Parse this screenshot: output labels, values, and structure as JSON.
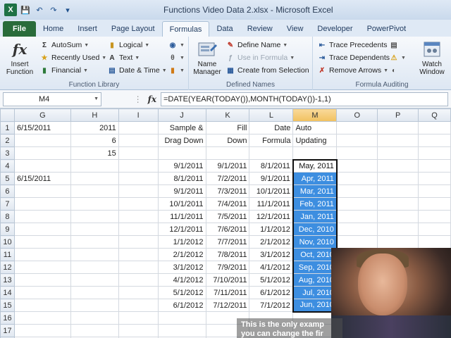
{
  "window": {
    "title": "Functions Video Data 2.xlsx - Microsoft Excel"
  },
  "ribbon_tabs": [
    {
      "label": "File"
    },
    {
      "label": "Home"
    },
    {
      "label": "Insert"
    },
    {
      "label": "Page Layout"
    },
    {
      "label": "Formulas"
    },
    {
      "label": "Data"
    },
    {
      "label": "Review"
    },
    {
      "label": "View"
    },
    {
      "label": "Developer"
    },
    {
      "label": "PowerPivot"
    }
  ],
  "active_tab": "Formulas",
  "ribbon": {
    "function_library": {
      "label": "Function Library",
      "insert_function": "Insert Function",
      "autosum": "AutoSum",
      "recently_used": "Recently Used",
      "financial": "Financial",
      "logical": "Logical",
      "text": "Text",
      "date_time": "Date & Time"
    },
    "defined_names": {
      "label": "Defined Names",
      "name_manager": "Name Manager",
      "define_name": "Define Name",
      "use_in_formula": "Use in Formula",
      "create_from_selection": "Create from Selection"
    },
    "formula_auditing": {
      "label": "Formula Auditing",
      "trace_precedents": "Trace Precedents",
      "trace_dependents": "Trace Dependents",
      "remove_arrows": "Remove Arrows",
      "watch_window": "Watch Window"
    }
  },
  "formula_bar": {
    "name_box": "M4",
    "fx": "fx",
    "formula": "=DATE(YEAR(TODAY()),MONTH(TODAY())-1,1)"
  },
  "grid": {
    "columns": [
      "G",
      "H",
      "I",
      "J",
      "K",
      "L",
      "M",
      "O",
      "P",
      "Q"
    ],
    "selected_column": "M",
    "rows": [
      {
        "num": "1",
        "G": "6/15/2011",
        "H": "2011",
        "I": "",
        "J": "Sample &",
        "K": "Fill",
        "L": "Date",
        "M": "Auto",
        "O": "",
        "P": "",
        "Q": ""
      },
      {
        "num": "2",
        "G": "",
        "H": "6",
        "I": "",
        "J": "Drag Down",
        "K": "Down",
        "L": "Formula",
        "M": "Updating",
        "O": "",
        "P": "",
        "Q": ""
      },
      {
        "num": "3",
        "G": "",
        "H": "15",
        "I": "",
        "J": "",
        "K": "",
        "L": "",
        "M": "",
        "O": "",
        "P": "",
        "Q": ""
      },
      {
        "num": "4",
        "G": "",
        "H": "",
        "I": "",
        "J": "9/1/2011",
        "K": "9/1/2011",
        "L": "8/1/2011",
        "M": "May, 2011",
        "O": "",
        "P": "",
        "Q": ""
      },
      {
        "num": "5",
        "G": "6/15/2011",
        "H": "",
        "I": "",
        "J": "8/1/2011",
        "K": "7/2/2011",
        "L": "9/1/2011",
        "M": "Apr, 2011",
        "O": "",
        "P": "",
        "Q": ""
      },
      {
        "num": "6",
        "G": "",
        "H": "",
        "I": "",
        "J": "9/1/2011",
        "K": "7/3/2011",
        "L": "10/1/2011",
        "M": "Mar, 2011",
        "O": "",
        "P": "",
        "Q": ""
      },
      {
        "num": "7",
        "G": "",
        "H": "",
        "I": "",
        "J": "10/1/2011",
        "K": "7/4/2011",
        "L": "11/1/2011",
        "M": "Feb, 2011",
        "O": "",
        "P": "",
        "Q": ""
      },
      {
        "num": "8",
        "G": "",
        "H": "",
        "I": "",
        "J": "11/1/2011",
        "K": "7/5/2011",
        "L": "12/1/2011",
        "M": "Jan, 2011",
        "O": "",
        "P": "",
        "Q": ""
      },
      {
        "num": "9",
        "G": "",
        "H": "",
        "I": "",
        "J": "12/1/2011",
        "K": "7/6/2011",
        "L": "1/1/2012",
        "M": "Dec, 2010",
        "O": "",
        "P": "",
        "Q": ""
      },
      {
        "num": "10",
        "G": "",
        "H": "",
        "I": "",
        "J": "1/1/2012",
        "K": "7/7/2011",
        "L": "2/1/2012",
        "M": "Nov, 2010",
        "O": "",
        "P": "",
        "Q": ""
      },
      {
        "num": "11",
        "G": "",
        "H": "",
        "I": "",
        "J": "2/1/2012",
        "K": "7/8/2011",
        "L": "3/1/2012",
        "M": "Oct, 2010",
        "O": "",
        "P": "",
        "Q": ""
      },
      {
        "num": "12",
        "G": "",
        "H": "",
        "I": "",
        "J": "3/1/2012",
        "K": "7/9/2011",
        "L": "4/1/2012",
        "M": "Sep, 2010",
        "O": "",
        "P": "",
        "Q": ""
      },
      {
        "num": "13",
        "G": "",
        "H": "",
        "I": "",
        "J": "4/1/2012",
        "K": "7/10/2011",
        "L": "5/1/2012",
        "M": "Aug, 2010",
        "O": "",
        "P": "",
        "Q": ""
      },
      {
        "num": "14",
        "G": "",
        "H": "",
        "I": "",
        "J": "5/1/2012",
        "K": "7/11/2011",
        "L": "6/1/2012",
        "M": "Jul, 2010",
        "O": "",
        "P": "",
        "Q": ""
      },
      {
        "num": "15",
        "G": "",
        "H": "",
        "I": "",
        "J": "6/1/2012",
        "K": "7/12/2011",
        "L": "7/1/2012",
        "M": "Jun, 2010",
        "O": "",
        "P": "",
        "Q": ""
      },
      {
        "num": "16",
        "G": "",
        "H": "",
        "I": "",
        "J": "",
        "K": "",
        "L": "",
        "M": "",
        "O": "",
        "P": "",
        "Q": ""
      },
      {
        "num": "17",
        "G": "",
        "H": "",
        "I": "",
        "J": "",
        "K": "",
        "L": "",
        "M": "",
        "O": "",
        "P": "",
        "Q": ""
      },
      {
        "num": "18",
        "G": "",
        "H": "",
        "I": "",
        "J": "",
        "K": "",
        "L": "",
        "M": "",
        "O": "",
        "P": "",
        "Q": ""
      }
    ]
  },
  "overlay": {
    "subtitle_line1": "This is the only examp",
    "subtitle_line2": "you can change the fir"
  },
  "colors": {
    "file_tab": "#2a6c3a",
    "selection_fill": "#3d8ee0",
    "header_selected": "#f1c15f"
  }
}
